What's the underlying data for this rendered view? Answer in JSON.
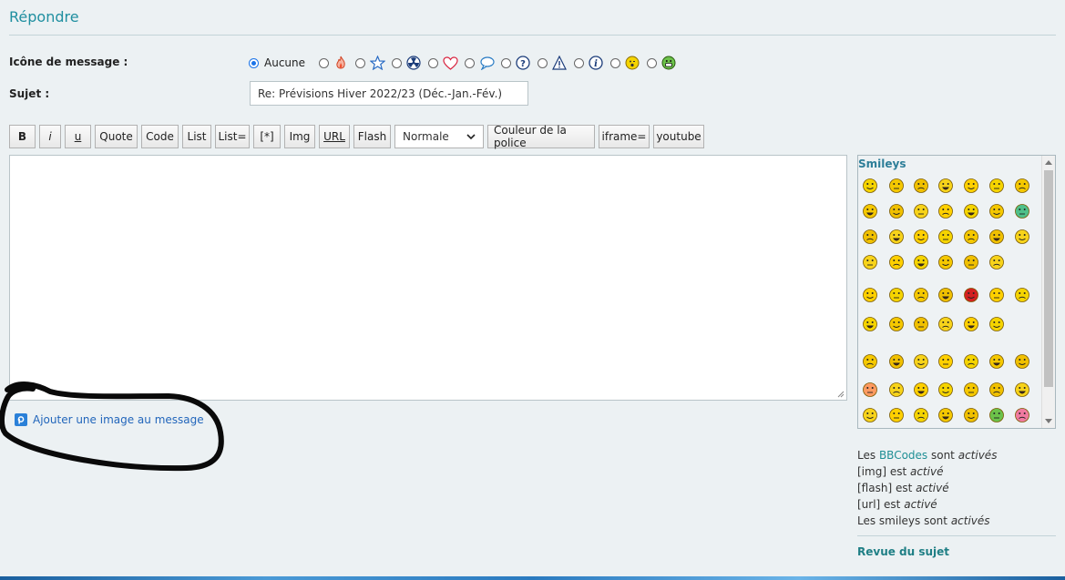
{
  "page": {
    "title": "Répondre"
  },
  "form": {
    "icon_label": "Icône de message :",
    "subject_label": "Sujet :",
    "subject_value": "Re: Prévisions Hiver 2022/23 (Déc.-Jan.-Fév.)",
    "icon_none_label": "Aucune",
    "icon_options": [
      "none",
      "fire-icon",
      "star-icon",
      "radioactive-icon",
      "heart-icon",
      "speech-bubble-icon",
      "question-icon",
      "warning-icon",
      "info-icon",
      "wink-smiley-icon",
      "grin-smiley-icon"
    ]
  },
  "toolbar": {
    "buttons": [
      "B",
      "i",
      "u",
      "Quote",
      "Code",
      "List",
      "List=",
      "[*]",
      "Img",
      "URL",
      "Flash"
    ],
    "font_size": "Normale",
    "buttons_after": [
      "Couleur de la police",
      "iframe=",
      "youtube"
    ]
  },
  "attachment": {
    "add_image_label": "Ajouter une image au message"
  },
  "smileys": {
    "title": "Smileys"
  },
  "status": {
    "bbcodes_prefix": "Les ",
    "bbcodes_link": "BBCodes",
    "bbcodes_suffix": " sont ",
    "bbcodes_state": "activés",
    "img_prefix": "[img] est ",
    "img_state": "activé",
    "flash_prefix": "[flash] est ",
    "flash_state": "activé",
    "url_prefix": "[url] est ",
    "url_state": "activé",
    "smileys_prefix": "Les smileys sont ",
    "smileys_state": "activés"
  },
  "review": {
    "label": "Revue du sujet"
  },
  "colors": {
    "accent": "#1f8fa0",
    "link": "#2266bb",
    "annotation": "#000000"
  }
}
